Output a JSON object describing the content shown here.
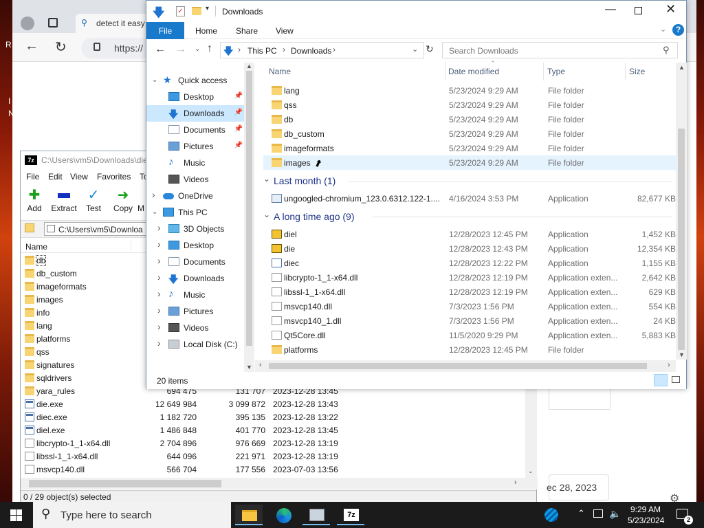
{
  "browser": {
    "tab_title": "detect it easy",
    "url": "https://",
    "date_card": "ec 28, 2023"
  },
  "desktop_fragments": {
    "a": "R",
    "b": "I",
    "c": "N"
  },
  "zip": {
    "title": "C:\\Users\\vm5\\Downloads\\die",
    "menu": [
      "File",
      "Edit",
      "View",
      "Favorites",
      "To"
    ],
    "tools": [
      {
        "label": "Add",
        "icon": "plus",
        "color": "#1aa01a"
      },
      {
        "label": "Extract",
        "icon": "minus",
        "color": "#1030c0"
      },
      {
        "label": "Test",
        "icon": "check",
        "color": "#1a8ad0"
      },
      {
        "label": "Copy",
        "icon": "arrow-right",
        "color": "#1aa01a"
      },
      {
        "label": "M",
        "icon": "",
        "color": "#000"
      }
    ],
    "path": "C:\\Users\\vm5\\Downloa",
    "col_name": "Name",
    "rows": [
      {
        "name": "db",
        "type": "folder",
        "size": "",
        "packed": "",
        "modified": ""
      },
      {
        "name": "db_custom",
        "type": "folder",
        "size": "",
        "packed": "",
        "modified": ""
      },
      {
        "name": "imageformats",
        "type": "folder",
        "size": "",
        "packed": "",
        "modified": ""
      },
      {
        "name": "images",
        "type": "folder",
        "size": "",
        "packed": "",
        "modified": ""
      },
      {
        "name": "info",
        "type": "folder",
        "size": "",
        "packed": "",
        "modified": ""
      },
      {
        "name": "lang",
        "type": "folder",
        "size": "",
        "packed": "",
        "modified": ""
      },
      {
        "name": "platforms",
        "type": "folder",
        "size": "",
        "packed": "",
        "modified": ""
      },
      {
        "name": "qss",
        "type": "folder",
        "size": "",
        "packed": "",
        "modified": ""
      },
      {
        "name": "signatures",
        "type": "folder",
        "size": "",
        "packed": "",
        "modified": ""
      },
      {
        "name": "sqldrivers",
        "type": "folder",
        "size": "",
        "packed": "",
        "modified": ""
      },
      {
        "name": "yara_rules",
        "type": "folder",
        "size": "694 475",
        "packed": "131 707",
        "modified": "2023-12-28 13:45"
      },
      {
        "name": "die.exe",
        "type": "exe",
        "size": "12 649 984",
        "packed": "3 099 872",
        "modified": "2023-12-28 13:43"
      },
      {
        "name": "diec.exe",
        "type": "exe",
        "size": "1 182 720",
        "packed": "395 135",
        "modified": "2023-12-28 13:22"
      },
      {
        "name": "diel.exe",
        "type": "exe",
        "size": "1 486 848",
        "packed": "401 770",
        "modified": "2023-12-28 13:45"
      },
      {
        "name": "libcrypto-1_1-x64.dll",
        "type": "dll",
        "size": "2 704 896",
        "packed": "976 669",
        "modified": "2023-12-28 13:19"
      },
      {
        "name": "libssl-1_1-x64.dll",
        "type": "dll",
        "size": "644 096",
        "packed": "221 971",
        "modified": "2023-12-28 13:19"
      },
      {
        "name": "msvcp140.dll",
        "type": "dll",
        "size": "566 704",
        "packed": "177 556",
        "modified": "2023-07-03 13:56"
      }
    ],
    "status": "0 / 29 object(s) selected"
  },
  "explorer": {
    "title": "Downloads",
    "ribbon_tabs": [
      "File",
      "Home",
      "Share",
      "View"
    ],
    "breadcrumb": [
      "This PC",
      "Downloads"
    ],
    "search_placeholder": "Search Downloads",
    "tree": [
      {
        "label": "Quick access",
        "icon": "star",
        "indent": 0,
        "chev": "open",
        "pin": false,
        "selected": false
      },
      {
        "label": "Desktop",
        "icon": "desktop",
        "indent": 1,
        "chev": "",
        "pin": true,
        "selected": false
      },
      {
        "label": "Downloads",
        "icon": "download",
        "indent": 1,
        "chev": "",
        "pin": true,
        "selected": true
      },
      {
        "label": "Documents",
        "icon": "doc",
        "indent": 1,
        "chev": "",
        "pin": true,
        "selected": false
      },
      {
        "label": "Pictures",
        "icon": "pic",
        "indent": 1,
        "chev": "",
        "pin": true,
        "selected": false
      },
      {
        "label": "Music",
        "icon": "music",
        "indent": 1,
        "chev": "",
        "pin": false,
        "selected": false
      },
      {
        "label": "Videos",
        "icon": "video",
        "indent": 1,
        "chev": "",
        "pin": false,
        "selected": false
      },
      {
        "label": "OneDrive",
        "icon": "cloud",
        "indent": 0,
        "chev": "closed",
        "pin": false,
        "selected": false
      },
      {
        "label": "This PC",
        "icon": "pc",
        "indent": 0,
        "chev": "open",
        "pin": false,
        "selected": false
      },
      {
        "label": "3D Objects",
        "icon": "cube",
        "indent": 1,
        "chev": "closed",
        "pin": false,
        "selected": false
      },
      {
        "label": "Desktop",
        "icon": "desktop",
        "indent": 1,
        "chev": "closed",
        "pin": false,
        "selected": false
      },
      {
        "label": "Documents",
        "icon": "doc",
        "indent": 1,
        "chev": "closed",
        "pin": false,
        "selected": false
      },
      {
        "label": "Downloads",
        "icon": "download",
        "indent": 1,
        "chev": "closed",
        "pin": false,
        "selected": false
      },
      {
        "label": "Music",
        "icon": "music",
        "indent": 1,
        "chev": "closed",
        "pin": false,
        "selected": false
      },
      {
        "label": "Pictures",
        "icon": "pic",
        "indent": 1,
        "chev": "closed",
        "pin": false,
        "selected": false
      },
      {
        "label": "Videos",
        "icon": "video",
        "indent": 1,
        "chev": "closed",
        "pin": false,
        "selected": false
      },
      {
        "label": "Local Disk (C:)",
        "icon": "disk",
        "indent": 1,
        "chev": "closed",
        "pin": false,
        "selected": false
      }
    ],
    "columns": {
      "name": "Name",
      "date": "Date modified",
      "type": "Type",
      "size": "Size"
    },
    "groups": [
      {
        "title": "",
        "items": [
          {
            "name": "lang",
            "date": "5/23/2024 9:29 AM",
            "type": "File folder",
            "size": "",
            "icon": "folder"
          },
          {
            "name": "qss",
            "date": "5/23/2024 9:29 AM",
            "type": "File folder",
            "size": "",
            "icon": "folder"
          },
          {
            "name": "db",
            "date": "5/23/2024 9:29 AM",
            "type": "File folder",
            "size": "",
            "icon": "folder"
          },
          {
            "name": "db_custom",
            "date": "5/23/2024 9:29 AM",
            "type": "File folder",
            "size": "",
            "icon": "folder"
          },
          {
            "name": "imageformats",
            "date": "5/23/2024 9:29 AM",
            "type": "File folder",
            "size": "",
            "icon": "folder"
          },
          {
            "name": "images",
            "date": "5/23/2024 9:29 AM",
            "type": "File folder",
            "size": "",
            "icon": "folder",
            "hover": true
          }
        ]
      },
      {
        "title": "Last month (1)",
        "items": [
          {
            "name": "ungoogled-chromium_123.0.6312.122-1....",
            "date": "4/16/2024 3:53 PM",
            "type": "Application",
            "size": "82,677 KB",
            "icon": "setup"
          }
        ]
      },
      {
        "title": "A long time ago (9)",
        "items": [
          {
            "name": "diel",
            "date": "12/28/2023 12:45 PM",
            "type": "Application",
            "size": "1,452 KB",
            "icon": "die"
          },
          {
            "name": "die",
            "date": "12/28/2023 12:43 PM",
            "type": "Application",
            "size": "12,354 KB",
            "icon": "die"
          },
          {
            "name": "diec",
            "date": "12/28/2023 12:22 PM",
            "type": "Application",
            "size": "1,155 KB",
            "icon": "exe"
          },
          {
            "name": "libcrypto-1_1-x64.dll",
            "date": "12/28/2023 12:19 PM",
            "type": "Application exten...",
            "size": "2,642 KB",
            "icon": "dll"
          },
          {
            "name": "libssl-1_1-x64.dll",
            "date": "12/28/2023 12:19 PM",
            "type": "Application exten...",
            "size": "629 KB",
            "icon": "dll"
          },
          {
            "name": "msvcp140.dll",
            "date": "7/3/2023 1:56 PM",
            "type": "Application exten...",
            "size": "554 KB",
            "icon": "dll"
          },
          {
            "name": "msvcp140_1.dll",
            "date": "7/3/2023 1:56 PM",
            "type": "Application exten...",
            "size": "24 KB",
            "icon": "dll"
          },
          {
            "name": "Qt5Core.dll",
            "date": "11/5/2020 9:29 PM",
            "type": "Application exten...",
            "size": "5,883 KB",
            "icon": "dll"
          },
          {
            "name": "platforms",
            "date": "12/28/2023 12:45 PM",
            "type": "File folder",
            "size": "",
            "icon": "folder"
          }
        ]
      }
    ],
    "status": "20 items"
  },
  "taskbar": {
    "search_placeholder": "Type here to search",
    "time": "9:29 AM",
    "date": "5/23/2024",
    "notifications": "2",
    "colors": {
      "accent": "#0078d7",
      "taskbar": "#1b1b1b"
    }
  }
}
